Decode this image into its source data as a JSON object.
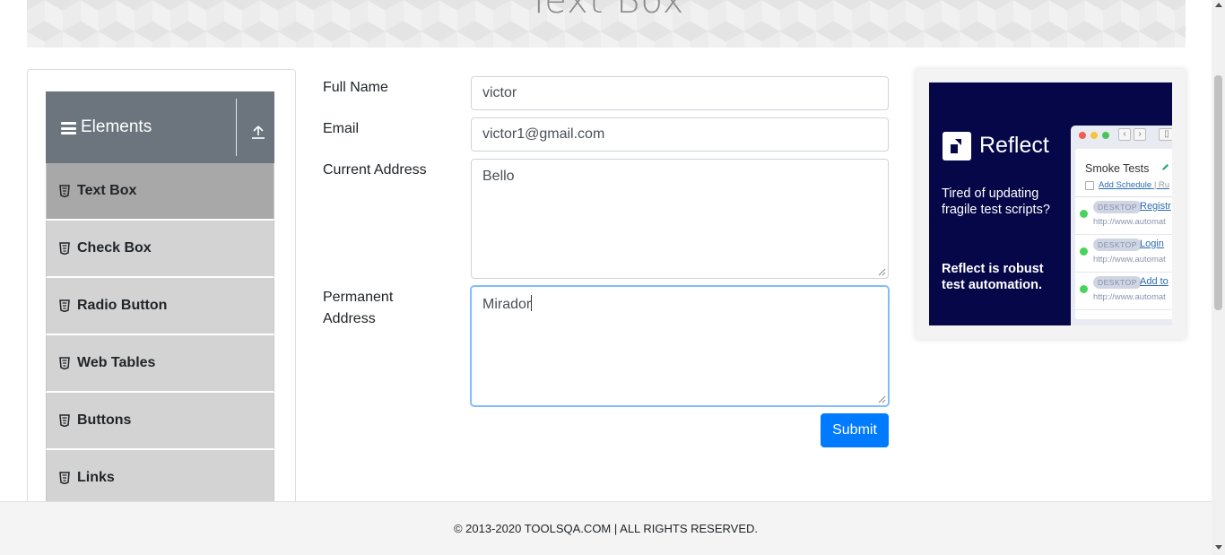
{
  "page": {
    "title": "Text Box"
  },
  "sidebar": {
    "group_title": "Elements",
    "items": [
      {
        "label": "Text Box",
        "active": true
      },
      {
        "label": "Check Box"
      },
      {
        "label": "Radio Button"
      },
      {
        "label": "Web Tables"
      },
      {
        "label": "Buttons"
      },
      {
        "label": "Links"
      }
    ]
  },
  "form": {
    "full_name": {
      "label": "Full Name",
      "value": "victor"
    },
    "email": {
      "label": "Email",
      "value": "victor1@gmail.com"
    },
    "current_address": {
      "label": "Current Address",
      "value": "Bello"
    },
    "permanent_address": {
      "label_line1": "Permanent",
      "label_line2": "Address",
      "value": "Mirador"
    },
    "submit_label": "Submit"
  },
  "ad": {
    "brand": "Reflect",
    "tagline": "Tired of updating fragile test scripts?",
    "pitch": "Reflect is robust test automation.",
    "suite_title": "Smoke Tests",
    "add_schedule": "Add Schedule",
    "run_partial": "| Ru",
    "tests": [
      {
        "badge": "DESKTOP",
        "name": "Registr",
        "url": "http://www.automat"
      },
      {
        "badge": "DESKTOP",
        "name": "Login",
        "url": "http://www.automat"
      },
      {
        "badge": "DESKTOP",
        "name": "Add to",
        "url": "http://www.automat"
      }
    ]
  },
  "footer": {
    "text": "© 2013-2020 TOOLSQA.COM | ALL RIGHTS RESERVED."
  },
  "colors": {
    "primary": "#007bff",
    "sidebar_header": "#6c757d",
    "menu_item": "#d3d3d3",
    "menu_active": "#a8a8a8",
    "ad_bg": "#060748"
  }
}
